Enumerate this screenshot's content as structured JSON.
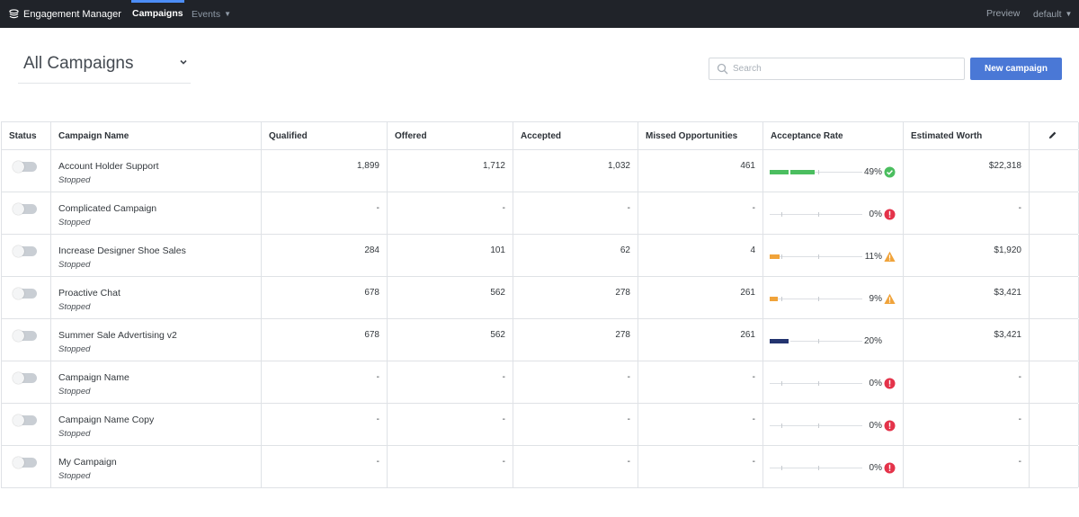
{
  "app": {
    "name": "Engagement Manager"
  },
  "nav": {
    "campaigns": "Campaigns",
    "events": "Events",
    "preview": "Preview",
    "workspace": "default"
  },
  "page": {
    "title": "All Campaigns"
  },
  "search": {
    "placeholder": "Search",
    "value": ""
  },
  "actions": {
    "new_campaign": "New campaign"
  },
  "colors": {
    "topbar": "#202329",
    "accent": "#4c8df6",
    "button": "#4a78d6",
    "good": "#4bbe5f",
    "warn": "#f0a33a",
    "error": "#e4334a",
    "neutral": "#23346f"
  },
  "table": {
    "columns": [
      "Status",
      "Campaign Name",
      "Qualified",
      "Offered",
      "Accepted",
      "Missed Opportunities",
      "Acceptance Rate",
      "Estimated Worth"
    ],
    "rows": [
      {
        "name": "Account Holder Support",
        "status": "Stopped",
        "qualified": "1,899",
        "offered": "1,712",
        "accepted": "1,032",
        "missed": "461",
        "rate": "49%",
        "rate_value": 49,
        "level": "good",
        "worth": "$22,318"
      },
      {
        "name": "Complicated Campaign",
        "status": "Stopped",
        "qualified": "-",
        "offered": "-",
        "accepted": "-",
        "missed": "-",
        "rate": "0%",
        "rate_value": 0,
        "level": "error",
        "worth": "-"
      },
      {
        "name": "Increase Designer Shoe Sales",
        "status": "Stopped",
        "qualified": "284",
        "offered": "101",
        "accepted": "62",
        "missed": "4",
        "rate": "11%",
        "rate_value": 11,
        "level": "warn",
        "worth": "$1,920"
      },
      {
        "name": "Proactive Chat",
        "status": "Stopped",
        "qualified": "678",
        "offered": "562",
        "accepted": "278",
        "missed": "261",
        "rate": "9%",
        "rate_value": 9,
        "level": "warn",
        "worth": "$3,421"
      },
      {
        "name": "Summer Sale Advertising v2",
        "status": "Stopped",
        "qualified": "678",
        "offered": "562",
        "accepted": "278",
        "missed": "261",
        "rate": "20%",
        "rate_value": 20,
        "level": "neutral",
        "worth": "$3,421"
      },
      {
        "name": "Campaign Name",
        "status": "Stopped",
        "qualified": "-",
        "offered": "-",
        "accepted": "-",
        "missed": "-",
        "rate": "0%",
        "rate_value": 0,
        "level": "error",
        "worth": "-"
      },
      {
        "name": "Campaign Name Copy",
        "status": "Stopped",
        "qualified": "-",
        "offered": "-",
        "accepted": "-",
        "missed": "-",
        "rate": "0%",
        "rate_value": 0,
        "level": "error",
        "worth": "-"
      },
      {
        "name": "My Campaign",
        "status": "Stopped",
        "qualified": "-",
        "offered": "-",
        "accepted": "-",
        "missed": "-",
        "rate": "0%",
        "rate_value": 0,
        "level": "error",
        "worth": "-"
      }
    ]
  }
}
